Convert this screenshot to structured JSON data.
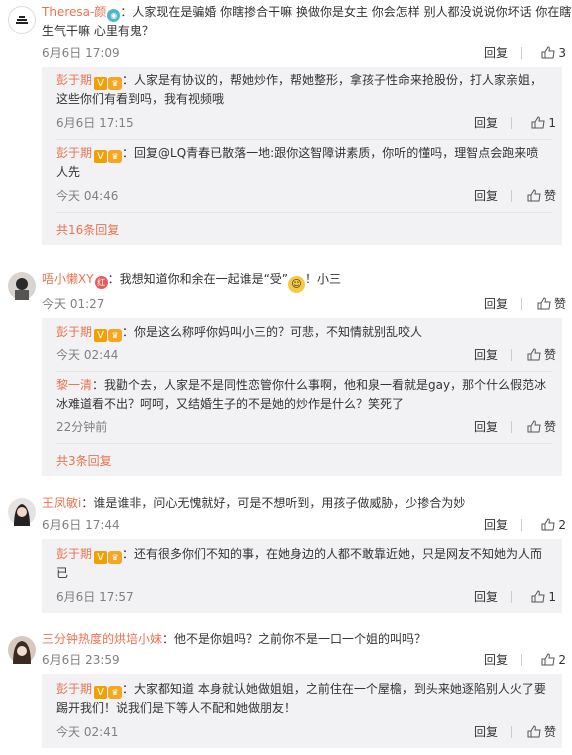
{
  "comments": [
    {
      "user": "Theresa-颜",
      "text": "：人家现在是骗婚 你瞎掺合干嘛 换做你是女主 你会怎样 别人都没说说你坏话 你在瞎",
      "text2": "生气干嘛 心里有鬼？",
      "time": "6月6日 17:09",
      "reply": "回复",
      "likes": "3",
      "subs": [
        {
          "user": "彭于期",
          "text": "：人家是有协议的，帮她炒作，帮她整形，拿孩子性命来抢股份，打人家亲姐，",
          "text2": "这些你们有看到吗，我有视频哦",
          "time": "6月6日 17:15",
          "reply": "回复",
          "likes": "1"
        },
        {
          "user": "彭于期",
          "text": "：回复@LQ青春已散落一地:跟你这智障讲素质，你听的懂吗，理智点会跑来喷",
          "text2": "人先",
          "time": "今天 04:46",
          "reply": "回复",
          "likes": "赞"
        }
      ],
      "more": "共16条回复"
    },
    {
      "user": "唔小懒XY",
      "text": "：我想知道你和余在一起谁是“受”",
      "text_after": "！小三",
      "time": "今天 01:27",
      "reply": "回复",
      "likes": "赞",
      "subs": [
        {
          "user": "彭于期",
          "text": "：你是这么称呼你妈叫小三的？可悲，不知情就别乱咬人",
          "time": "今天 02:44",
          "reply": "回复",
          "likes": "赞"
        },
        {
          "user": "黎一清",
          "text": "：我勸个去，人家是不是同性恋管你什么事啊，他和泉一看就是gay，那个什么假范冰",
          "text2": "冰难道看不出？呵呵，又结婚生子的不是她的炒作是什么？笑死了",
          "time": "22分钟前",
          "reply": "回复",
          "likes": "赞"
        }
      ],
      "more": "共3条回复"
    },
    {
      "user": "王凤敏i",
      "text": "：谁是谁非，问心无愧就好，可是不想听到，用孩子做威胁，少掺合为妙",
      "time": "6月6日 17:44",
      "reply": "回复",
      "likes": "2",
      "subs": [
        {
          "user": "彭于期",
          "text": "：还有很多你们不知的事，在她身边的人都不敢靠近她，只是网友不知她为人而",
          "text2": "已",
          "time": "6月6日 17:57",
          "reply": "回复",
          "likes": "1"
        }
      ]
    },
    {
      "user": "三分钟热度的烘培小妹",
      "text": "：他不是你姐吗？之前你不是一口一个姐的叫吗？",
      "time": "6月6日 23:59",
      "reply": "回复",
      "likes": "2",
      "subs": [
        {
          "user": "彭于期",
          "text": "：大家都知道 本身就认她做姐姐，之前住在一个屋檐，到头来她逐陷别人火了要",
          "text2": "踢开我们！说我们是下等人不配和她做朋友！",
          "time": "今天 02:41",
          "reply": "回复",
          "likes": "赞"
        }
      ]
    }
  ],
  "colors": {
    "username": "#eb7350",
    "subbox": "#f2f2f5",
    "vbadge": "#f0a000"
  },
  "icons": {
    "like": "thumbs-up-icon",
    "verified": "v-badge-icon",
    "level": "level-badge-icon"
  }
}
